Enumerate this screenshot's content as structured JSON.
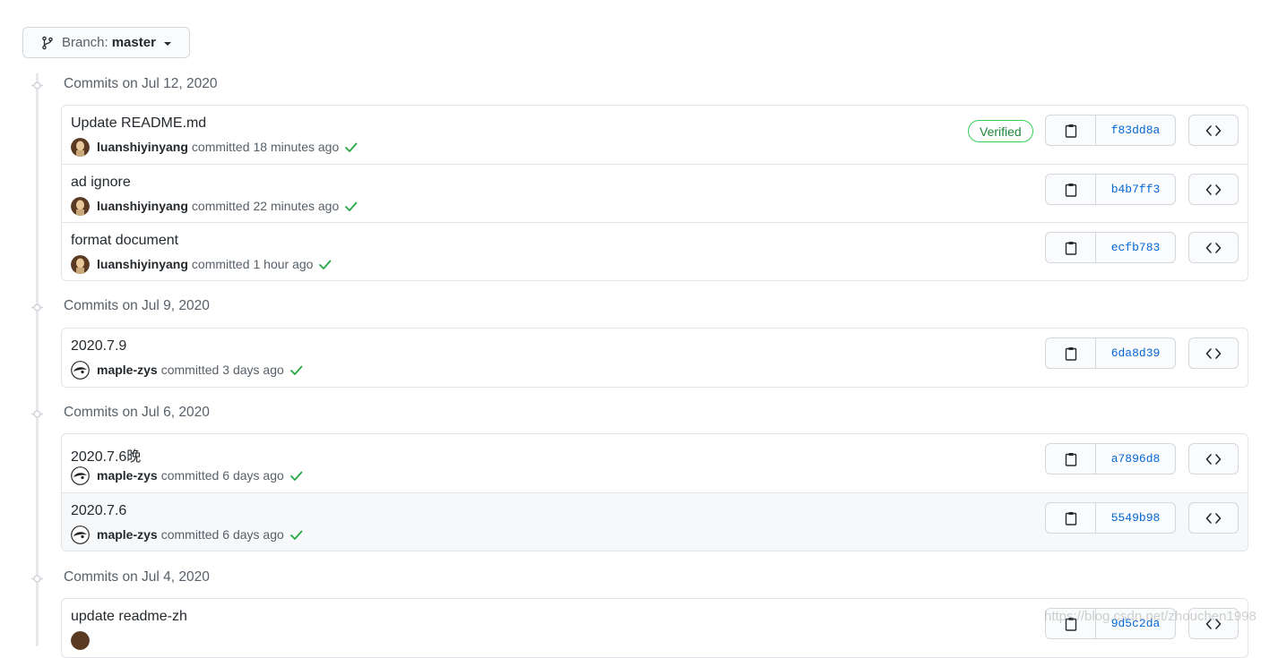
{
  "branch": {
    "prefix": "Branch:",
    "name": "master"
  },
  "groups": [
    {
      "heading": "Commits on Jul 12, 2020",
      "commits": [
        {
          "title": "Update README.md",
          "author": "luanshiyinyang",
          "action": "committed",
          "time": "18 minutes ago",
          "verified": "Verified",
          "sha": "f83dd8a",
          "avatar": "avatar-luanshiyinyang"
        },
        {
          "title": "ad ignore",
          "author": "luanshiyinyang",
          "action": "committed",
          "time": "22 minutes ago",
          "sha": "b4b7ff3",
          "avatar": "avatar-luanshiyinyang"
        },
        {
          "title": "format document",
          "author": "luanshiyinyang",
          "action": "committed",
          "time": "1 hour ago",
          "sha": "ecfb783",
          "avatar": "avatar-luanshiyinyang"
        }
      ]
    },
    {
      "heading": "Commits on Jul 9, 2020",
      "commits": [
        {
          "title": "2020.7.9",
          "author": "maple-zys",
          "action": "committed",
          "time": "3 days ago",
          "sha": "6da8d39",
          "avatar": "avatar-maple-zys"
        }
      ]
    },
    {
      "heading": "Commits on Jul 6, 2020",
      "commits": [
        {
          "title": "2020.7.6晚",
          "author": "maple-zys",
          "action": "committed",
          "time": "6 days ago",
          "sha": "a7896d8",
          "avatar": "avatar-maple-zys"
        },
        {
          "title": "2020.7.6",
          "author": "maple-zys",
          "action": "committed",
          "time": "6 days ago",
          "sha": "5549b98",
          "avatar": "avatar-maple-zys",
          "highlighted": true
        }
      ]
    },
    {
      "heading": "Commits on Jul 4, 2020",
      "commits": [
        {
          "title": "update readme-zh",
          "sha": "9d5c2da",
          "avatar": "avatar-partial"
        }
      ]
    }
  ],
  "watermark": "https://blog.csdn.net/zhouchen1998",
  "colors": {
    "link": "#0366d6",
    "verified": "#22863a",
    "check": "#28a745",
    "border": "#e1e4e8"
  },
  "icons": {
    "branch": "git-branch-icon",
    "clipboard": "clipboard-icon",
    "browse": "code-icon",
    "check": "check-icon",
    "timeline": "commit-node-icon"
  }
}
